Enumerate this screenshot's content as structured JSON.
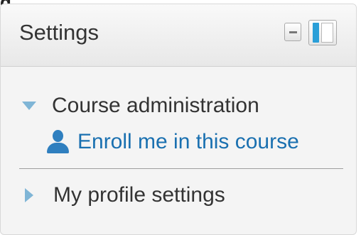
{
  "block": {
    "title": "Settings",
    "controls": {
      "hide_icon": "minus-icon",
      "dock_icon": "dock-panel-icon"
    }
  },
  "tree": {
    "course_admin": {
      "label": "Course administration",
      "state": "expanded",
      "children": [
        {
          "label": "Enroll me in this course",
          "icon": "user-icon"
        }
      ]
    },
    "profile": {
      "label": "My profile settings",
      "state": "collapsed"
    }
  },
  "colors": {
    "link": "#1a70b0",
    "triangle": "#7fb5d6",
    "dock_accent": "#2a9fd8"
  }
}
